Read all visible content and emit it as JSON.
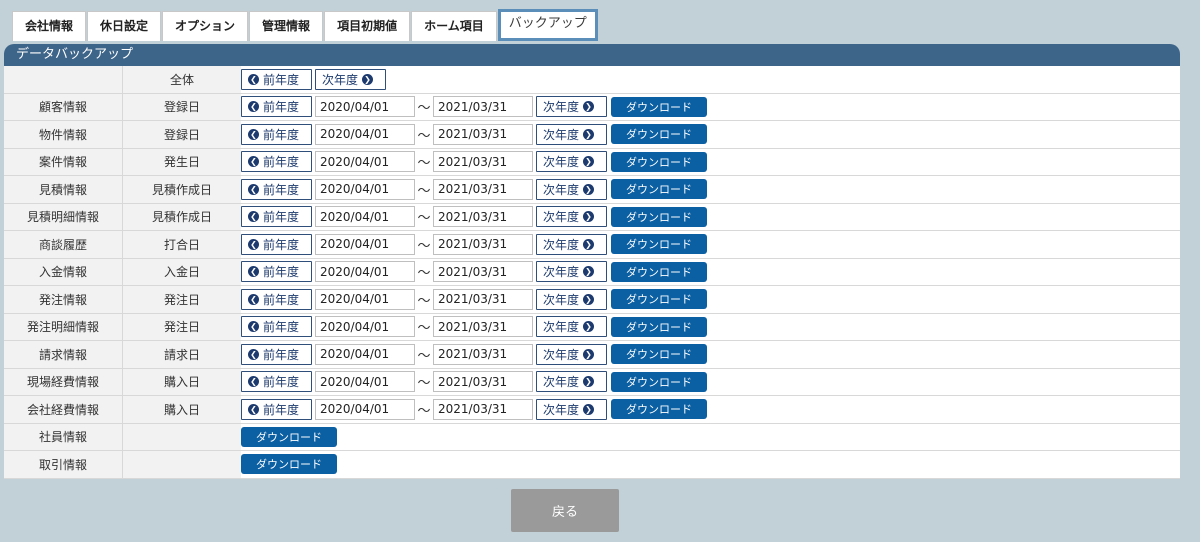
{
  "tabs": [
    "会社情報",
    "休日設定",
    "オプション",
    "管理情報",
    "項目初期値",
    "ホーム項目",
    "バックアップ"
  ],
  "active_tab": "バックアップ",
  "panel_title": "データバックアップ",
  "all_row": {
    "label": "全体",
    "prev": "前年度",
    "next": "次年度"
  },
  "buttons": {
    "prev": "前年度",
    "next": "次年度",
    "download": "ダウンロード",
    "back": "戻る"
  },
  "rows": [
    {
      "name": "顧客情報",
      "field": "登録日",
      "from": "2020/04/01",
      "to": "2021/03/31"
    },
    {
      "name": "物件情報",
      "field": "登録日",
      "from": "2020/04/01",
      "to": "2021/03/31"
    },
    {
      "name": "案件情報",
      "field": "発生日",
      "from": "2020/04/01",
      "to": "2021/03/31"
    },
    {
      "name": "見積情報",
      "field": "見積作成日",
      "from": "2020/04/01",
      "to": "2021/03/31"
    },
    {
      "name": "見積明細情報",
      "field": "見積作成日",
      "from": "2020/04/01",
      "to": "2021/03/31"
    },
    {
      "name": "商談履歴",
      "field": "打合日",
      "from": "2020/04/01",
      "to": "2021/03/31"
    },
    {
      "name": "入金情報",
      "field": "入金日",
      "from": "2020/04/01",
      "to": "2021/03/31"
    },
    {
      "name": "発注情報",
      "field": "発注日",
      "from": "2020/04/01",
      "to": "2021/03/31"
    },
    {
      "name": "発注明細情報",
      "field": "発注日",
      "from": "2020/04/01",
      "to": "2021/03/31"
    },
    {
      "name": "請求情報",
      "field": "請求日",
      "from": "2020/04/01",
      "to": "2021/03/31"
    },
    {
      "name": "現場経費情報",
      "field": "購入日",
      "from": "2020/04/01",
      "to": "2021/03/31"
    },
    {
      "name": "会社経費情報",
      "field": "購入日",
      "from": "2020/04/01",
      "to": "2021/03/31"
    }
  ],
  "simple_rows": [
    {
      "name": "社員情報"
    },
    {
      "name": "取引情報"
    }
  ],
  "tilde": "～",
  "icons": {
    "prev": "chevron-left-circle-icon",
    "next": "chevron-right-circle-icon"
  },
  "colors": {
    "header": "#3d6489",
    "download": "#0b5fa3",
    "background": "#c2d1d8",
    "back": "#9a9a9a"
  }
}
